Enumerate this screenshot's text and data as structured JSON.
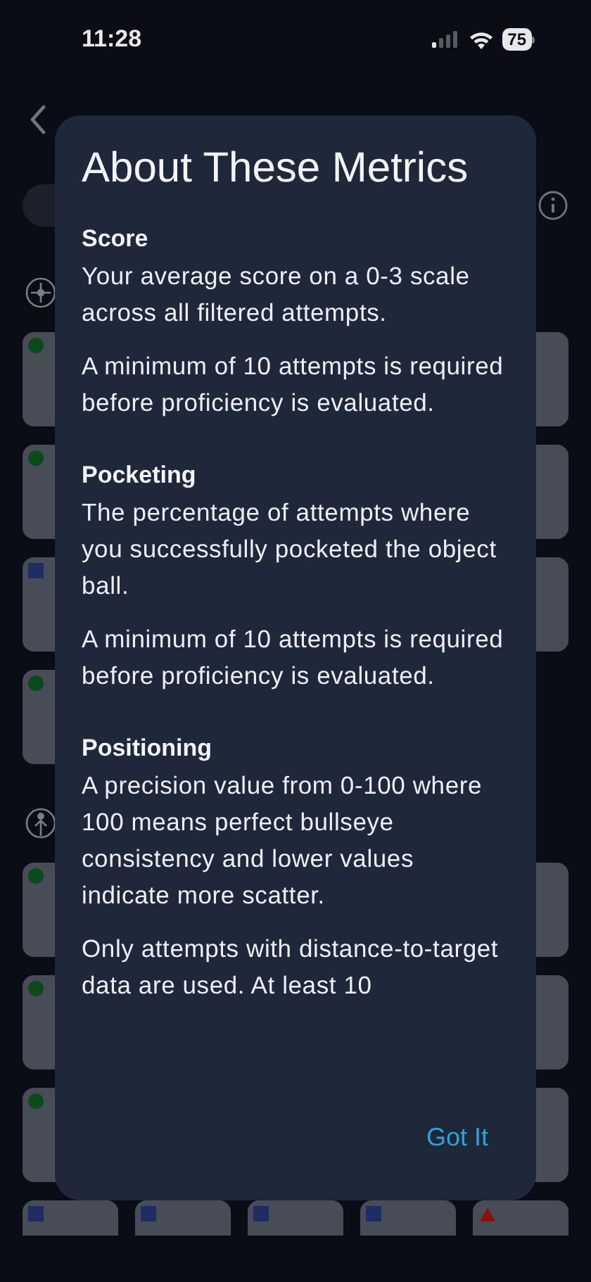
{
  "status_bar": {
    "time": "11:28",
    "battery": "75"
  },
  "sections": [
    {
      "kind": "crosshair",
      "rows": [
        {
          "tiles": [
            {
              "kind": "dot",
              "color": "#0c4a1c"
            },
            {
              "kind": "plain"
            }
          ]
        },
        {
          "tiles": [
            {
              "kind": "dot",
              "color": "#0c4a1c"
            },
            {
              "kind": "plain"
            }
          ]
        },
        {
          "tiles": [
            {
              "kind": "square",
              "color": "#1e2d63"
            },
            {
              "kind": "plain"
            }
          ]
        },
        {
          "tiles": [
            {
              "kind": "dot",
              "color": "#0c4a1c"
            }
          ]
        }
      ]
    },
    {
      "kind": "figure",
      "rows": [
        {
          "tiles": [
            {
              "kind": "dot",
              "color": "#0c4a1c"
            },
            {
              "kind": "plain"
            }
          ]
        },
        {
          "tiles": [
            {
              "kind": "dot",
              "color": "#0c4a1c"
            },
            {
              "kind": "plain"
            }
          ]
        },
        {
          "tiles": [
            {
              "kind": "dot",
              "color": "#0c4a1c"
            },
            {
              "kind": "plain"
            }
          ]
        },
        {
          "tiles": [
            {
              "kind": "square",
              "color": "#1e2d63"
            },
            {
              "kind": "square",
              "color": "#1e2d63"
            },
            {
              "kind": "square",
              "color": "#1e2d63"
            },
            {
              "kind": "square",
              "color": "#1e2d63"
            },
            {
              "kind": "triangle",
              "color": "#8a1010"
            }
          ]
        }
      ]
    }
  ],
  "dialog": {
    "title": "About These Metrics",
    "sections": [
      {
        "heading": "Score",
        "paragraphs": [
          "Your average score on a 0-3 scale across all filtered attempts.",
          "A minimum of 10 attempts is required before proficiency is evaluated."
        ]
      },
      {
        "heading": "Pocketing",
        "paragraphs": [
          "The percentage of attempts where you successfully pocketed the object ball.",
          "A minimum of 10 attempts is required before proficiency is evaluated."
        ]
      },
      {
        "heading": "Positioning",
        "paragraphs": [
          "A precision value from 0-100 where 100 means perfect bullseye consistency and lower values indicate more scatter.",
          "Only attempts with distance-to-target data are used. At least 10"
        ]
      }
    ],
    "button": "Got It"
  }
}
